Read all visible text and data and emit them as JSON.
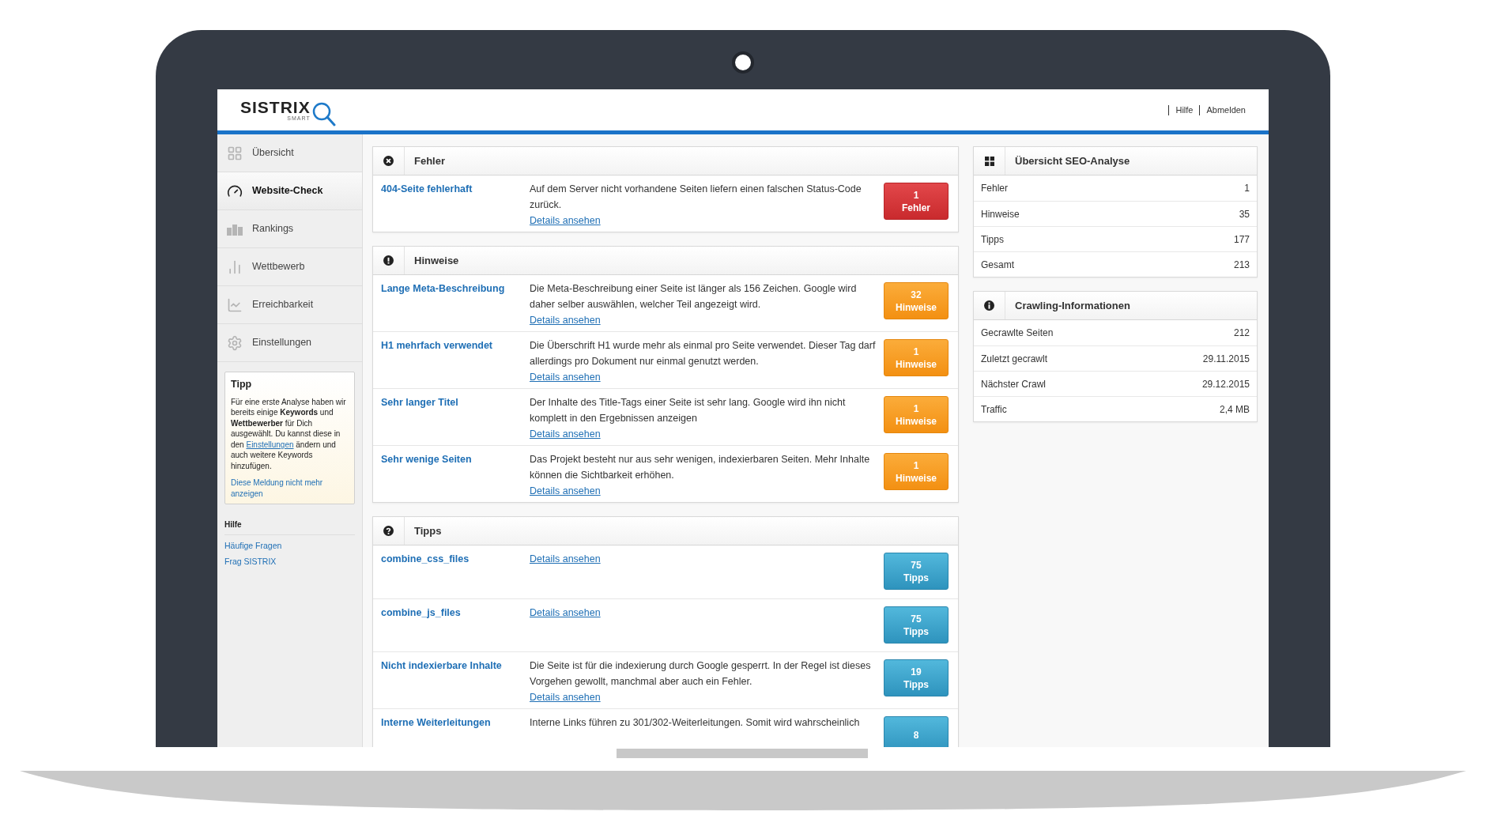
{
  "header": {
    "logo": "SISTRIX",
    "logo_sub": "SMART",
    "links": [
      "Hilfe",
      "Abmelden"
    ]
  },
  "sidebar": {
    "items": [
      {
        "label": "Übersicht",
        "selected": false
      },
      {
        "label": "Website-Check",
        "selected": true
      },
      {
        "label": "Rankings",
        "selected": false
      },
      {
        "label": "Wettbewerb",
        "selected": false
      },
      {
        "label": "Erreichbarkeit",
        "selected": false
      },
      {
        "label": "Einstellungen",
        "selected": false
      }
    ],
    "tip": {
      "title": "Tipp",
      "text": "Für eine erste Analyse haben wir bereits einige **Keywords** und **Wettbewerber** für Dich ausgewählt. Du kannst diese in den",
      "link": "Einstellungen",
      "text_after": "ändern und auch weitere Keywords hinzufügen.",
      "dismiss": "Diese Meldung nicht mehr anzeigen"
    },
    "help": {
      "title": "Hilfe",
      "links": [
        "Häufige Fragen",
        "Frag SISTRIX"
      ]
    }
  },
  "sections": [
    {
      "kind": "error",
      "title": "Fehler",
      "rows": [
        {
          "title": "404-Seite fehlerhaft",
          "description": "Auf dem Server nicht vorhandene Seiten liefern einen falschen Status-Code zurück.",
          "link": "Details ansehen",
          "count": "1",
          "unit": "Fehler"
        }
      ]
    },
    {
      "kind": "warning",
      "title": "Hinweise",
      "rows": [
        {
          "title": "Lange Meta-Beschreibung",
          "description": "Die Meta-Beschreibung einer Seite ist länger als 156 Zeichen. Google wird daher selber auswählen, welcher Teil angezeigt wird.",
          "link": "Details ansehen",
          "count": "32",
          "unit": "Hinweise"
        },
        {
          "title": "H1 mehrfach verwendet",
          "description": "Die Überschrift H1 wurde mehr als einmal pro Seite verwendet. Dieser Tag darf allerdings pro Dokument nur einmal genutzt werden.",
          "link": "Details ansehen",
          "count": "1",
          "unit": "Hinweise"
        },
        {
          "title": "Sehr langer Titel",
          "description": "Der Inhalte des Title-Tags einer Seite ist sehr lang. Google wird ihn nicht komplett in den Ergebnissen anzeigen",
          "link": "Details ansehen",
          "count": "1",
          "unit": "Hinweise"
        },
        {
          "title": "Sehr wenige Seiten",
          "description": "Das Projekt besteht nur aus sehr wenigen, indexierbaren Seiten. Mehr Inhalte können die Sichtbarkeit erhöhen.",
          "link": "Details ansehen",
          "count": "1",
          "unit": "Hinweise"
        }
      ]
    },
    {
      "kind": "tip",
      "title": "Tipps",
      "rows": [
        {
          "title": "combine_css_files",
          "link": "Details ansehen",
          "count": "75",
          "unit": "Tipps"
        },
        {
          "title": "combine_js_files",
          "link": "Details ansehen",
          "count": "75",
          "unit": "Tipps"
        },
        {
          "title": "Nicht indexierbare Inhalte",
          "description": "Die Seite ist für die indexierung durch Google gesperrt. In der Regel ist dieses Vorgehen gewollt, manchmal aber auch ein Fehler.",
          "link": "Details ansehen",
          "count": "19",
          "unit": "Tipps"
        },
        {
          "title": "Interne Weiterleitungen",
          "description": "Interne Links führen zu 301/302-Weiterleitungen. Somit wird wahrscheinlich",
          "count": "8"
        }
      ]
    }
  ],
  "side_panels": [
    {
      "kind": "grid",
      "title": "Übersicht SEO-Analyse",
      "rows": [
        {
          "label": "Fehler",
          "value": "1"
        },
        {
          "label": "Hinweise",
          "value": "35"
        },
        {
          "label": "Tipps",
          "value": "177"
        },
        {
          "label": "Gesamt",
          "value": "213"
        }
      ]
    },
    {
      "kind": "info",
      "title": "Crawling-Informationen",
      "rows": [
        {
          "label": "Gecrawlte Seiten",
          "value": "212"
        },
        {
          "label": "Zuletzt gecrawlt",
          "value": "29.11.2015"
        },
        {
          "label": "Nächster Crawl",
          "value": "29.12.2015"
        },
        {
          "label": "Traffic",
          "value": "2,4 MB"
        }
      ]
    }
  ]
}
